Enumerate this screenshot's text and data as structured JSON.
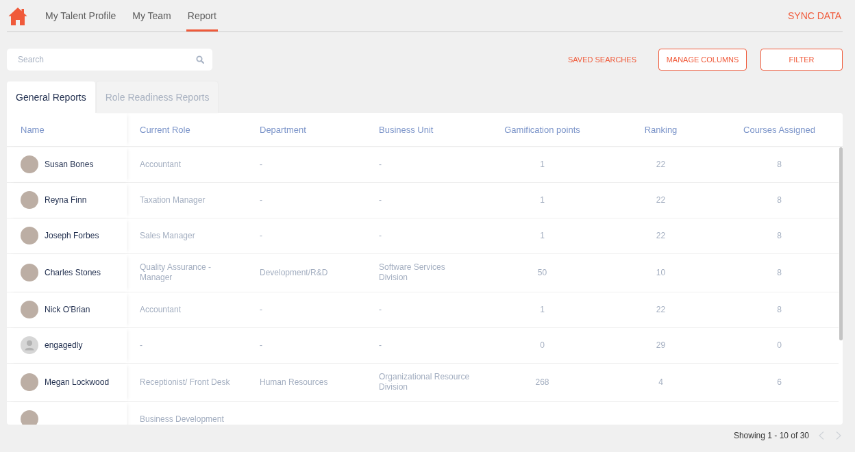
{
  "nav": {
    "items": [
      {
        "label": "My Talent Profile",
        "selected": false
      },
      {
        "label": "My Team",
        "selected": false
      },
      {
        "label": "Report",
        "selected": true
      }
    ],
    "action": "SYNC DATA"
  },
  "toolbar": {
    "search": {
      "placeholder": "Search"
    },
    "actions": [
      {
        "label": "SAVED SEARCHES",
        "kind": "link"
      },
      {
        "label": "MANAGE COLUMNS",
        "kind": "outlined"
      },
      {
        "label": "FILTER",
        "kind": "outlined"
      }
    ]
  },
  "tabs": [
    {
      "label": "General Reports",
      "selected": true
    },
    {
      "label": "Role Readiness Reports",
      "selected": false
    }
  ],
  "table": {
    "columns": [
      {
        "label": "Name",
        "kind": "person"
      },
      {
        "label": "Current Role",
        "kind": "text"
      },
      {
        "label": "Department",
        "kind": "text"
      },
      {
        "label": "Business Unit",
        "kind": "text"
      },
      {
        "label": "Gamification points",
        "kind": "number"
      },
      {
        "label": "Ranking",
        "kind": "number"
      },
      {
        "label": "Courses Assigned",
        "kind": "number"
      }
    ],
    "rows": [
      {
        "avatar": {
          "kind": "photo"
        },
        "name": "Susan Bones",
        "current_role": "Accountant",
        "department": "-",
        "business_unit": "-",
        "gamification_points": "1",
        "ranking": "22",
        "courses_assigned": "8"
      },
      {
        "avatar": {
          "kind": "photo"
        },
        "name": "Reyna Finn",
        "current_role": "Taxation Manager",
        "department": "-",
        "business_unit": "-",
        "gamification_points": "1",
        "ranking": "22",
        "courses_assigned": "8"
      },
      {
        "avatar": {
          "kind": "photo"
        },
        "name": "Joseph Forbes",
        "current_role": "Sales Manager",
        "department": "-",
        "business_unit": "-",
        "gamification_points": "1",
        "ranking": "22",
        "courses_assigned": "8"
      },
      {
        "avatar": {
          "kind": "photo"
        },
        "name": "Charles Stones",
        "current_role": "Quality Assurance - Manager",
        "department": "Development/R&D",
        "business_unit": "Software Services Division",
        "gamification_points": "50",
        "ranking": "10",
        "courses_assigned": "8"
      },
      {
        "avatar": {
          "kind": "photo"
        },
        "name": "Nick O'Brian",
        "current_role": "Accountant",
        "department": "-",
        "business_unit": "-",
        "gamification_points": "1",
        "ranking": "22",
        "courses_assigned": "8"
      },
      {
        "avatar": {
          "kind": "silhouette"
        },
        "name": "engagedly",
        "current_role": "-",
        "department": "-",
        "business_unit": "-",
        "gamification_points": "0",
        "ranking": "29",
        "courses_assigned": "0"
      },
      {
        "avatar": {
          "kind": "photo"
        },
        "name": "Megan Lockwood",
        "current_role": "Receptionist/ Front Desk",
        "department": "Human Resources",
        "business_unit": "Organizational Resource Division",
        "gamification_points": "268",
        "ranking": "4",
        "courses_assigned": "6"
      },
      {
        "avatar": {
          "kind": "photo"
        },
        "current_role": "Business Development"
      }
    ]
  },
  "pagination": {
    "summary": "Showing 1 - 10 of 30"
  }
}
